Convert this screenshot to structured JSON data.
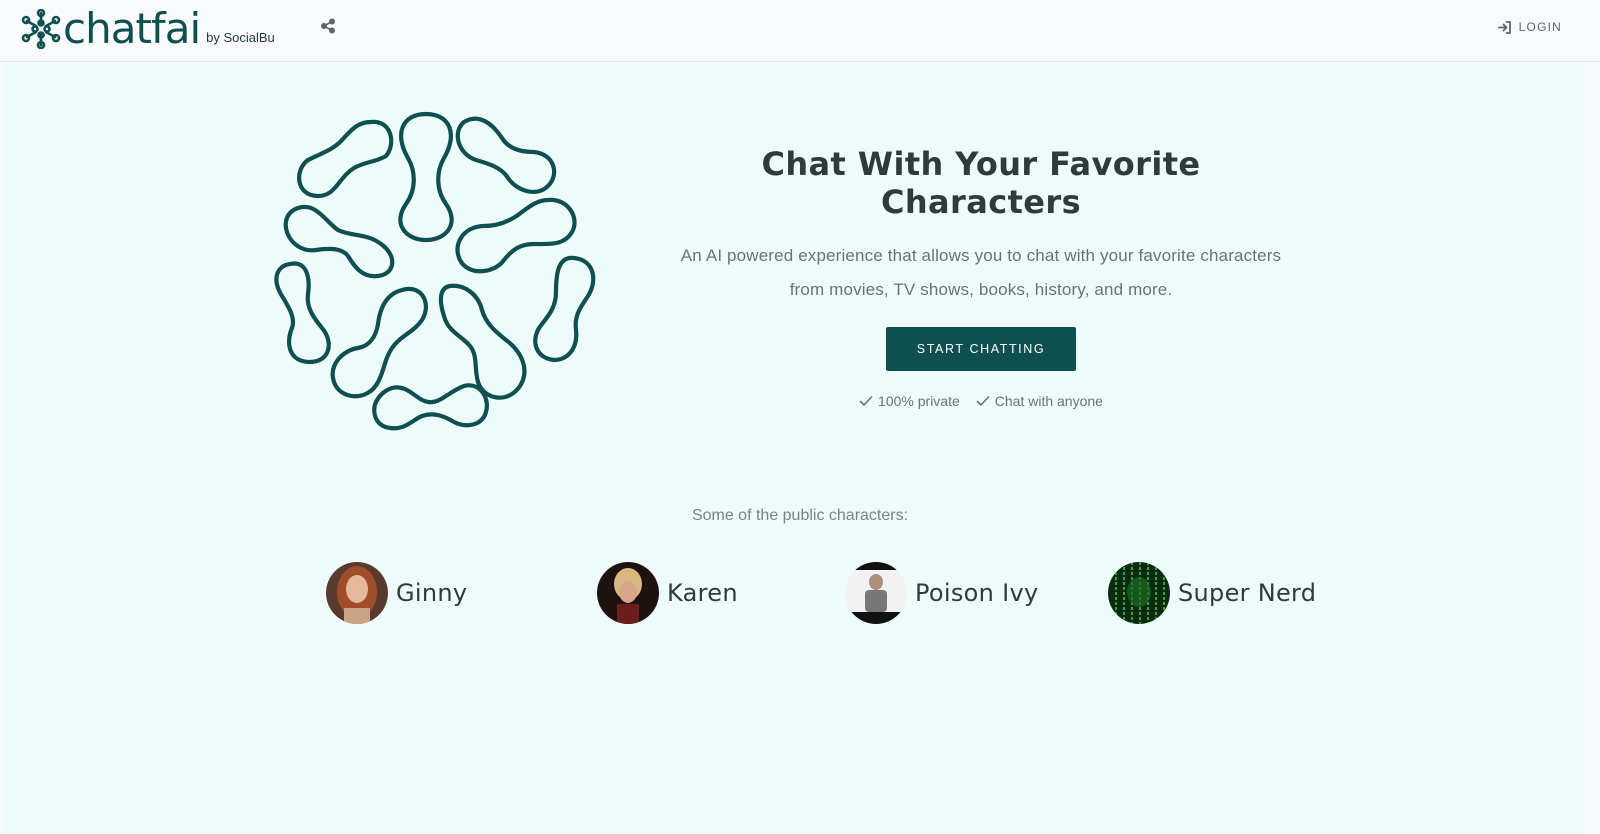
{
  "header": {
    "brand_name": "chatfai",
    "brand_suffix": "by SocialBu",
    "share_icon": "share-icon",
    "login_label": "LOGIN",
    "login_icon": "sign-in-icon"
  },
  "hero": {
    "title": "Chat With Your Favorite Characters",
    "subtitle_line1": "An AI powered experience that allows you to chat with your favorite characters",
    "subtitle_line2": "from movies, TV shows, books, history, and more.",
    "cta_label": "START CHATTING",
    "perks": [
      "100% private",
      "Chat with anyone"
    ]
  },
  "public_characters": {
    "label": "Some of the public characters:",
    "items": [
      {
        "name": "Ginny"
      },
      {
        "name": "Karen"
      },
      {
        "name": "Poison Ivy"
      },
      {
        "name": "Super Nerd"
      }
    ]
  },
  "colors": {
    "brand": "#0e5052",
    "hero_background": "#eefbfb",
    "topbar_background": "#f8fafb"
  }
}
